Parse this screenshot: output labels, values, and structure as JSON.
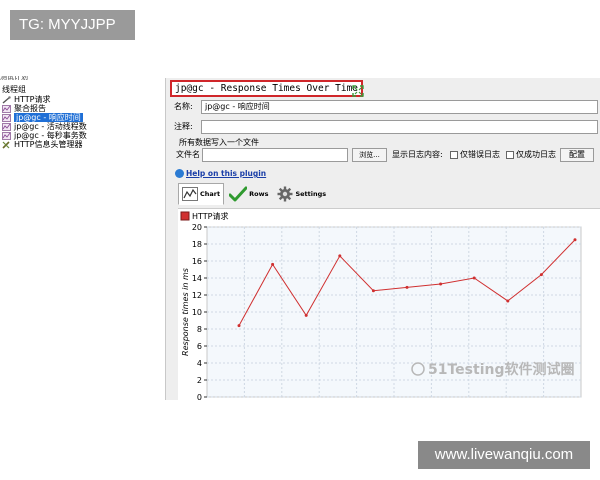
{
  "tag_badge": "TG: MYYJJPP",
  "tree": {
    "cutoff_text": "测试计划",
    "items": [
      {
        "label": "线程组",
        "icon": "thread-group-icon"
      },
      {
        "label": "HTTP请求",
        "icon": "pipette-icon"
      },
      {
        "label": "聚合报告",
        "icon": "chart-icon"
      },
      {
        "label": "jp@gc - 响应时间",
        "icon": "chart-icon",
        "selected": true
      },
      {
        "label": "jp@gc - 活动线程数",
        "icon": "chart-icon"
      },
      {
        "label": "jp@gc - 每秒事务数",
        "icon": "chart-icon"
      },
      {
        "label": "HTTP信息头管理器",
        "icon": "wrench-icon"
      }
    ]
  },
  "panel": {
    "title": "jp@gc - Response Times Over Time",
    "name_label": "名称:",
    "name_value": "jp@gc - 响应时间",
    "comment_label": "注释:",
    "comment_value": "",
    "file_section": "所有数据写入一个文件",
    "filename_label": "文件名",
    "filename_value": "",
    "browse_label": "浏览...",
    "log_label": "显示日志内容:",
    "errors_only": "仅错误日志",
    "success_only": "仅成功日志",
    "configure_label": "配置",
    "help_link": "Help on this plugin"
  },
  "tabs": [
    {
      "label": "Chart",
      "icon": "chart-icon",
      "active": true
    },
    {
      "label": "Rows",
      "icon": "checkmark-icon",
      "active": false
    },
    {
      "label": "Settings",
      "icon": "gear-icon",
      "active": false
    }
  ],
  "chart_data": {
    "type": "line",
    "title": "",
    "ylabel": "Response times in ms",
    "xlabel": "",
    "ylim": [
      0,
      20
    ],
    "yticks": [
      0,
      2,
      4,
      6,
      8,
      10,
      12,
      14,
      16,
      18,
      20
    ],
    "grid": true,
    "legend": "top-left",
    "series": [
      {
        "name": "HTTP请求",
        "color": "#d03030",
        "values": [
          8.4,
          15.6,
          9.6,
          16.6,
          12.5,
          12.9,
          13.3,
          14.0,
          11.3,
          14.4,
          18.5
        ]
      }
    ]
  },
  "watermark": "51Testing软件测试圈",
  "website": "www.livewanqiu.com"
}
